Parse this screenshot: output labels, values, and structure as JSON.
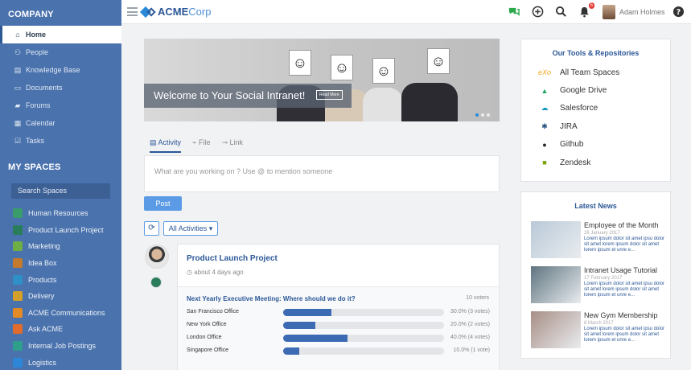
{
  "sidebar": {
    "company_heading": "COMPANY",
    "nav": [
      {
        "label": "Home",
        "icon": "home-icon",
        "glyph": "⌂",
        "active": true
      },
      {
        "label": "People",
        "icon": "people-icon",
        "glyph": "⚇"
      },
      {
        "label": "Knowledge Base",
        "icon": "book-icon",
        "glyph": "▤"
      },
      {
        "label": "Documents",
        "icon": "folder-icon",
        "glyph": "▭"
      },
      {
        "label": "Forums",
        "icon": "chat-icon",
        "glyph": "▰"
      },
      {
        "label": "Calendar",
        "icon": "calendar-icon",
        "glyph": "▦"
      },
      {
        "label": "Tasks",
        "icon": "tasks-icon",
        "glyph": "☑"
      }
    ],
    "spaces_heading": "MY SPACES",
    "search_placeholder": "Search Spaces",
    "spaces": [
      {
        "label": "Human Resources",
        "color": "#3a9b6b"
      },
      {
        "label": "Product Launch Project",
        "color": "#2a7d5b"
      },
      {
        "label": "Marketing",
        "color": "#6fae44"
      },
      {
        "label": "Idea Box",
        "color": "#c47a2c"
      },
      {
        "label": "Products",
        "color": "#2f8fc7"
      },
      {
        "label": "Delivery",
        "color": "#d3a12b"
      },
      {
        "label": "ACME Communications",
        "color": "#e28b24"
      },
      {
        "label": "Ask ACME",
        "color": "#e06b2b"
      },
      {
        "label": "Internal Job Postings",
        "color": "#2e9f8a"
      },
      {
        "label": "Logistics",
        "color": "#2e86d6"
      }
    ]
  },
  "topbar": {
    "logo_acme": "ACME",
    "logo_corp": "Corp",
    "notification_count": "5",
    "user_name": "Adam Holmes"
  },
  "banner": {
    "headline": "Welcome to Your Social Intranet!",
    "read_more": "Read More"
  },
  "composer": {
    "tabs": [
      "Activity",
      "File",
      "Link"
    ],
    "placeholder": "What are you working on ? Use @ to mention someone",
    "post_label": "Post",
    "filter_label": "All Activities ▾"
  },
  "activity": {
    "space_title": "Product Launch Project",
    "time": "about 4 days ago",
    "poll": {
      "question": "Next Yearly Executive Meeting: Where should we do it?",
      "voters": "10 voters",
      "options": [
        {
          "label": "San Francisco Office",
          "percent": 30,
          "result": "30.0% (3 votes)"
        },
        {
          "label": "New York Office",
          "percent": 20,
          "result": "20.0% (2 votes)"
        },
        {
          "label": "London Office",
          "percent": 40,
          "result": "40.0% (4 votes)"
        },
        {
          "label": "Singapore Office",
          "percent": 10,
          "result": "10.0% (1 vote)"
        }
      ]
    }
  },
  "tools": {
    "heading": "Our Tools & Repositories",
    "items": [
      {
        "label": "All Team Spaces",
        "icon": "exo-icon",
        "glyph": "eXo",
        "color": "#f5a623"
      },
      {
        "label": "Google Drive",
        "icon": "google-drive-icon",
        "glyph": "▲",
        "color": "#1fa463"
      },
      {
        "label": "Salesforce",
        "icon": "salesforce-icon",
        "glyph": "☁",
        "color": "#1798c1"
      },
      {
        "label": "JIRA",
        "icon": "jira-icon",
        "glyph": "✱",
        "color": "#205081"
      },
      {
        "label": "Github",
        "icon": "github-icon",
        "glyph": "●",
        "color": "#222222"
      },
      {
        "label": "Zendesk",
        "icon": "zendesk-icon",
        "glyph": "■",
        "color": "#78a300"
      }
    ]
  },
  "news": {
    "heading": "Latest News",
    "items": [
      {
        "title": "Employee of the Month",
        "date": "26 January 2017",
        "excerpt": "Lorem ipsum dolor sit amet ipsu dolor sit amet lorem ipsum dolor sit amet lorem ipsum et unre e...",
        "thumb": "#b9c9d8"
      },
      {
        "title": "Intranet Usage Tutorial",
        "date": "17 February 2017",
        "excerpt": "Lorem ipsum dolor sit amet ipsu dolor sit amet lorem ipsum dolor sit amet lorem ipsum et unre e...",
        "thumb": "#5f7480"
      },
      {
        "title": "New Gym Membership",
        "date": "8 March 2017",
        "excerpt": "Lorem ipsum dolor sit amet ipsu dolor sit amet lorem ipsum dolor sit amet lorem ipsum et unre e...",
        "thumb": "#a88f86"
      }
    ]
  }
}
